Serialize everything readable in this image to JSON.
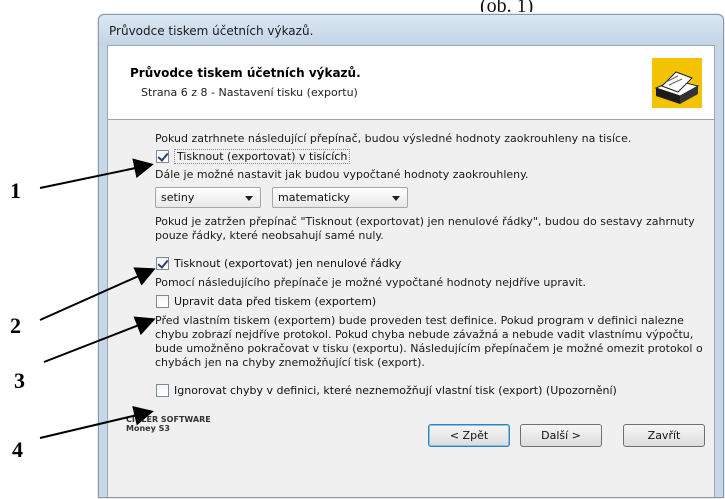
{
  "top_crop_text": "(ob. 1)",
  "window": {
    "title": "Průvodce tiskem účetních výkazů."
  },
  "header": {
    "title": "Průvodce tiskem účetních výkazů.",
    "subtitle": "Strana 6 z 8 - Nastavení tisku (exportu)",
    "icon": "printer-wizard-icon"
  },
  "content": {
    "intro1": "Pokud zatrhnete následující přepínač, budou výsledné hodnoty zaokrouhleny na tisíce.",
    "cb_thousands": {
      "label": "Tisknout (exportovat) v tisících",
      "checked": true
    },
    "intro2": "Dále je možné nastavit jak budou vypočtané hodnoty zaokrouhleny.",
    "select_precision": {
      "value": "setiny"
    },
    "select_method": {
      "value": "matematicky"
    },
    "intro3": "Pokud je zatržen přepínač \"Tisknout (exportovat) jen nenulové řádky\", budou do sestavy zahrnuty pouze řádky, které neobsahují samé nuly.",
    "cb_nonzero": {
      "label": "Tisknout (exportovat) jen nenulové řádky",
      "checked": true
    },
    "intro4": "Pomocí následujícího přepínače je možné vypočtané hodnoty nejdříve upravit.",
    "cb_edit": {
      "label": "Upravit data před tiskem (exportem)",
      "checked": false
    },
    "intro5": "Před vlastním tiskem (exportem) bude proveden test definice. Pokud program v definici nalezne chybu zobrazí nejdříve protokol. Pokud chyba nebude závažná a nebude vadit vlastnímu výpočtu, bude umožněno pokračovat v tisku (exportu). Následujícím přepínačem je možné omezit protokol o chybách jen na chyby znemožňující tisk (export).",
    "cb_ignore": {
      "label": "Ignorovat chyby v definici, které neznemožňují vlastní tisk (export) (Upozornění)",
      "checked": false
    }
  },
  "footer": {
    "brand_line1": "CÍGLER SOFTWARE",
    "brand_line2": "Money S3",
    "back_label": "< Zpět",
    "next_label": "Další >",
    "close_label": "Zavřít"
  },
  "annotations": [
    "1",
    "2",
    "3",
    "4"
  ]
}
